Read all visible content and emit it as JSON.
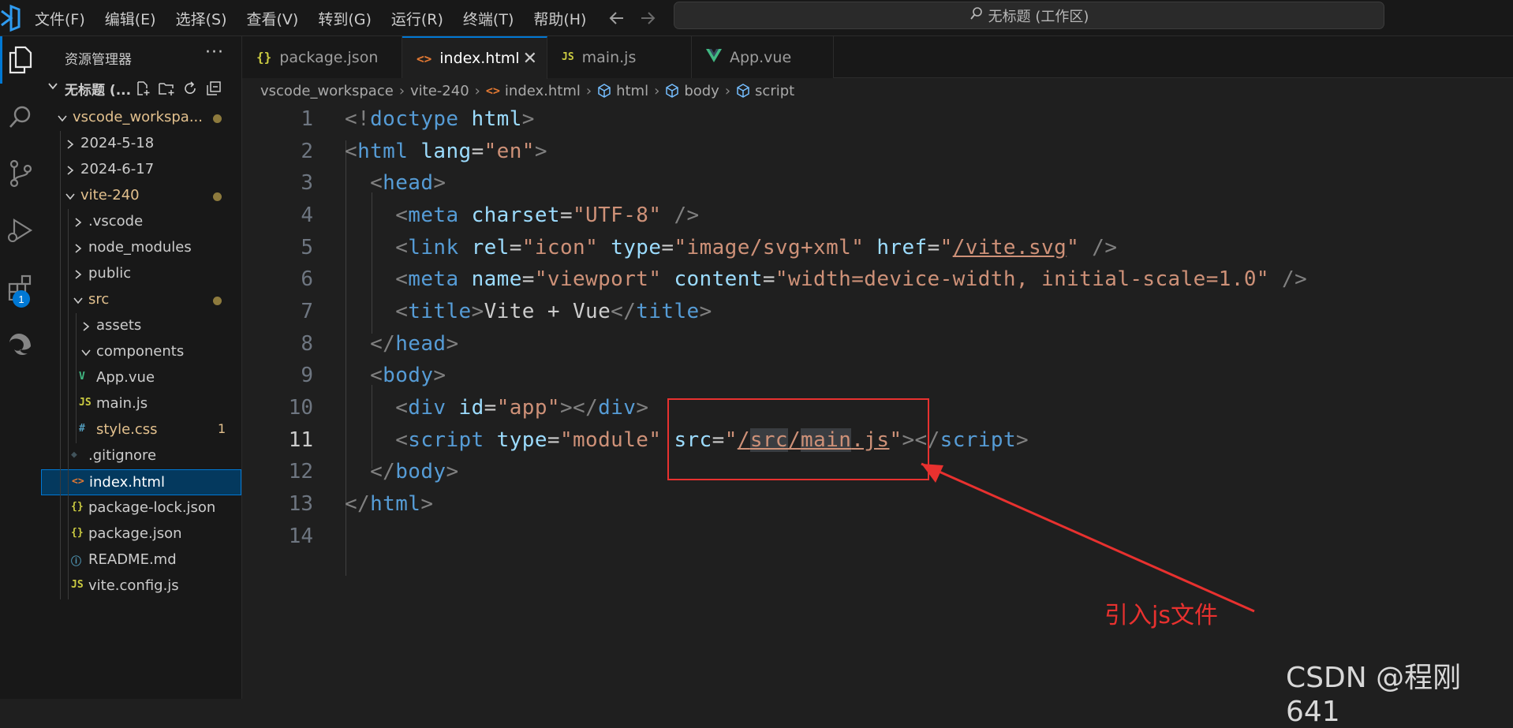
{
  "menu": [
    "文件(F)",
    "编辑(E)",
    "选择(S)",
    "查看(V)",
    "转到(G)",
    "运行(R)",
    "终端(T)",
    "帮助(H)"
  ],
  "command_center": "无标题 (工作区)",
  "sidebar": {
    "title": "资源管理器",
    "more": "···",
    "workspace_title": "无标题 (...",
    "tree": [
      {
        "label": "vscode_workspa...",
        "depth": 1,
        "kind": "folder-open",
        "modified": true
      },
      {
        "label": "2024-5-18",
        "depth": 2,
        "kind": "folder"
      },
      {
        "label": "2024-6-17",
        "depth": 2,
        "kind": "folder"
      },
      {
        "label": "vite-240",
        "depth": 2,
        "kind": "folder-open",
        "modified": true
      },
      {
        "label": ".vscode",
        "depth": 3,
        "kind": "folder"
      },
      {
        "label": "node_modules",
        "depth": 3,
        "kind": "folder"
      },
      {
        "label": "public",
        "depth": 3,
        "kind": "folder"
      },
      {
        "label": "src",
        "depth": 3,
        "kind": "folder-open",
        "modified": true
      },
      {
        "label": "assets",
        "depth": 4,
        "kind": "folder"
      },
      {
        "label": "components",
        "depth": 4,
        "kind": "folder-open"
      },
      {
        "label": "App.vue",
        "depth": 4,
        "kind": "vue"
      },
      {
        "label": "main.js",
        "depth": 4,
        "kind": "js"
      },
      {
        "label": "style.css",
        "depth": 4,
        "kind": "css",
        "problems": "1"
      },
      {
        "label": ".gitignore",
        "depth": 3,
        "kind": "git"
      },
      {
        "label": "index.html",
        "depth": 3,
        "kind": "html",
        "selected": true
      },
      {
        "label": "package-lock.json",
        "depth": 3,
        "kind": "json"
      },
      {
        "label": "package.json",
        "depth": 3,
        "kind": "json"
      },
      {
        "label": "README.md",
        "depth": 3,
        "kind": "info"
      },
      {
        "label": "vite.config.js",
        "depth": 3,
        "kind": "js"
      }
    ]
  },
  "tabs": [
    {
      "label": "package.json",
      "icon": "{}",
      "icon_color": "#cbcb41"
    },
    {
      "label": "index.html",
      "icon": "<>",
      "icon_color": "#e37933",
      "active": true,
      "close": "✕"
    },
    {
      "label": "main.js",
      "icon": "JS",
      "icon_color": "#cbcb41"
    },
    {
      "label": "App.vue",
      "icon": "V",
      "icon_color": "#41b883"
    }
  ],
  "breadcrumbs": [
    "vscode_workspace",
    "vite-240",
    "index.html",
    "html",
    "body",
    "script"
  ],
  "line_numbers": [
    "1",
    "2",
    "3",
    "4",
    "5",
    "6",
    "7",
    "8",
    "9",
    "10",
    "11",
    "12",
    "13",
    "14"
  ],
  "current_line": "11",
  "annotation_text": "引入js文件",
  "watermark": "CSDN @程刚641",
  "activity_badge": "1",
  "colors": {
    "accent": "#0078d4",
    "annotation": "#e8312f",
    "tag": "#569cd6",
    "attr": "#9cdcfe",
    "string": "#ce9178"
  }
}
